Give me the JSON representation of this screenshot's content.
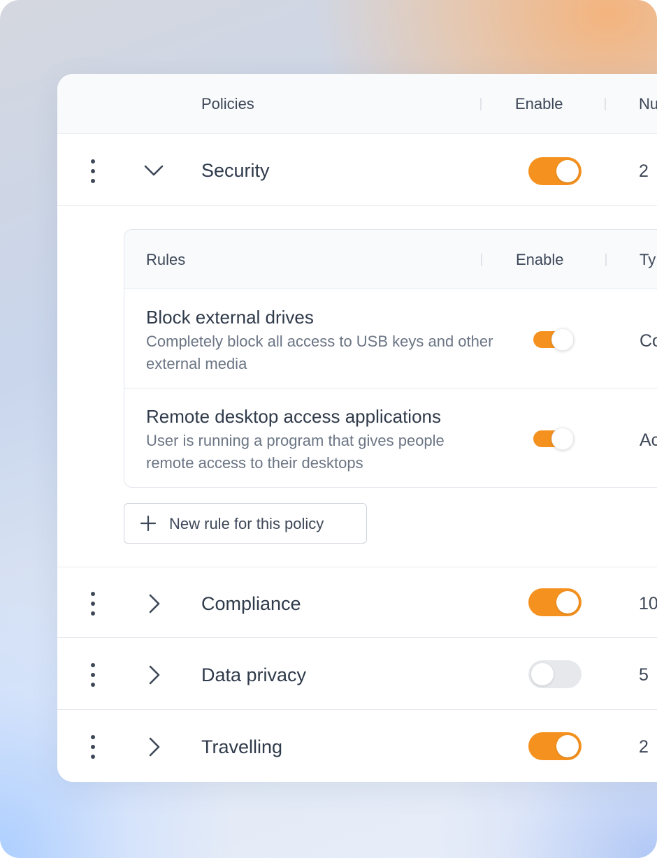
{
  "policies_table": {
    "columns": {
      "policies": "Policies",
      "enable": "Enable",
      "number": "Nu"
    },
    "rows": [
      {
        "name": "Security",
        "enabled": true,
        "count": "2",
        "expanded": true
      },
      {
        "name": "Compliance",
        "enabled": true,
        "count": "10",
        "expanded": false
      },
      {
        "name": "Data privacy",
        "enabled": false,
        "count": "5",
        "expanded": false
      },
      {
        "name": "Travelling",
        "enabled": true,
        "count": "2",
        "expanded": false
      }
    ]
  },
  "rules_table": {
    "columns": {
      "rules": "Rules",
      "enable": "Enable",
      "type": "Ty"
    },
    "rows": [
      {
        "title": "Block external drives",
        "description": "Completely block all access to USB keys and other external media",
        "enabled": true,
        "type": "Co"
      },
      {
        "title": "Remote desktop access applications",
        "description": "User is running a program that gives people remote access to their desktops",
        "enabled": true,
        "type": "Ac"
      }
    ]
  },
  "new_rule_button": "New rule for this policy",
  "colors": {
    "accent": "#f5921f",
    "toggle_off": "#e6e8ec",
    "text_primary": "#2f3a4a",
    "text_secondary": "#6b7584"
  },
  "icons": {
    "row_menu": "kebab-menu-icon",
    "expanded": "chevron-down-icon",
    "collapsed": "chevron-right-icon",
    "add": "plus-icon"
  }
}
